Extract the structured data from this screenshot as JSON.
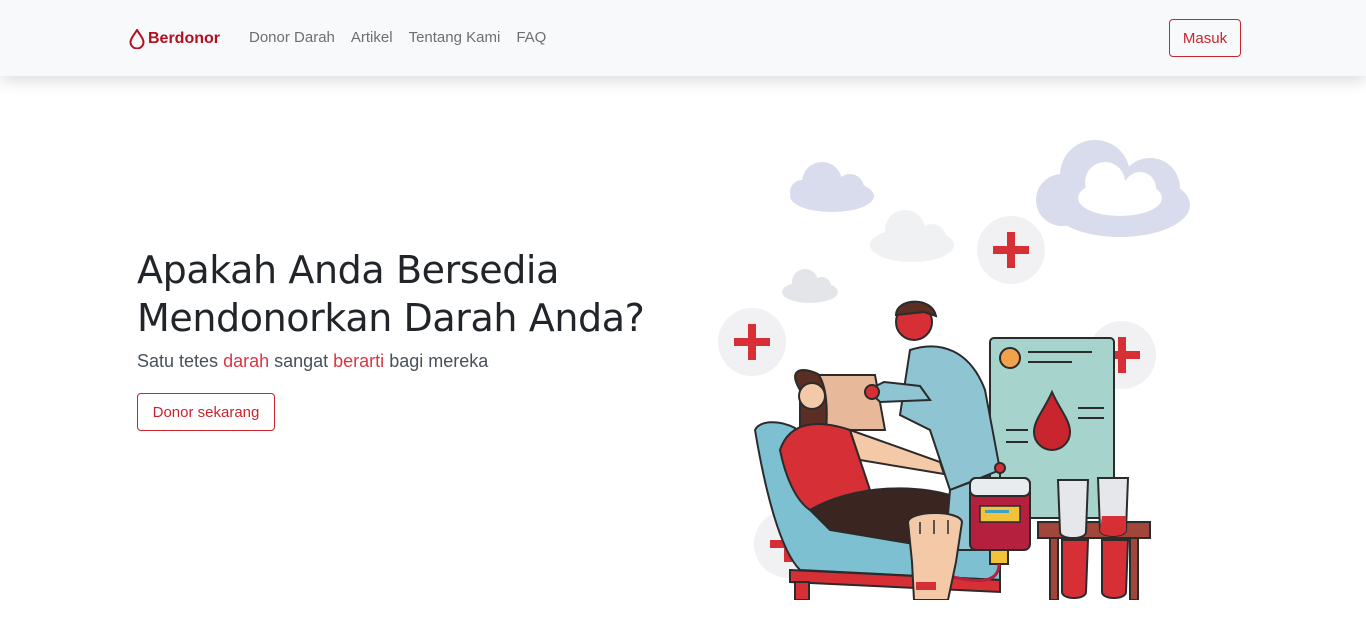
{
  "navbar": {
    "brand": "Berdonor",
    "brand_icon": "blood-drop-icon",
    "links": [
      {
        "label": "Donor Darah"
      },
      {
        "label": "Artikel"
      },
      {
        "label": "Tentang Kami"
      },
      {
        "label": "FAQ"
      }
    ],
    "login_label": "Masuk"
  },
  "hero": {
    "title_line1": "Apakah Anda Bersedia",
    "title_line2": "Mendonorkan Darah Anda?",
    "subtitle": {
      "part1": "Satu tetes ",
      "accent1": "darah",
      "part2": " sangat ",
      "accent2": "berarti",
      "part3": " bagi mereka"
    },
    "cta_label": "Donor sekarang"
  },
  "colors": {
    "brand": "#b30f1f",
    "accent": "#dc3545",
    "navbar_bg": "#f8f9fa"
  }
}
